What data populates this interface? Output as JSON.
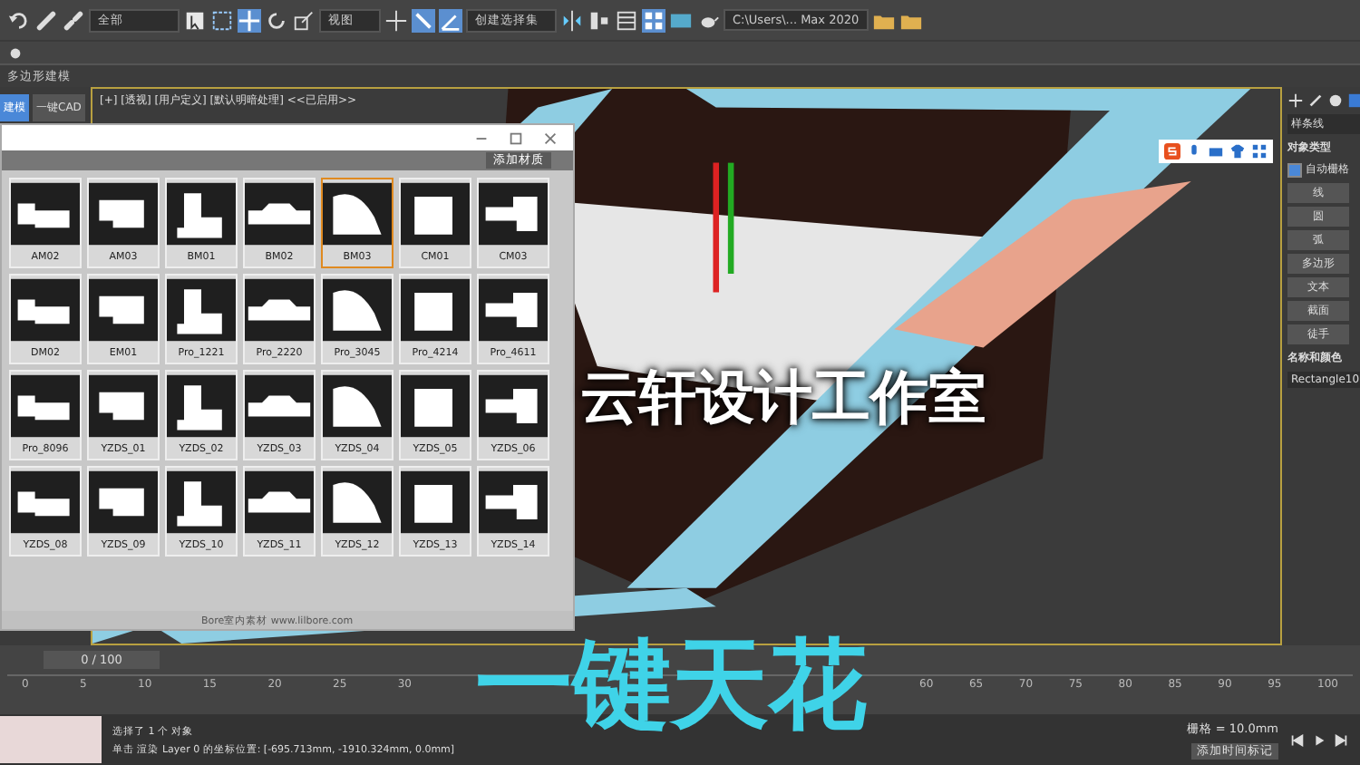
{
  "toolbar": {
    "selection_filter": "全部",
    "view_dropdown": "视图",
    "named_selection": "创建选择集",
    "path_field": "C:\\Users\\... Max 2020"
  },
  "ribbon_label": "多边形建模",
  "side_tabs": [
    {
      "label": "建模",
      "selected": true
    },
    {
      "label": "一键CAD",
      "selected": false
    }
  ],
  "viewport": {
    "label": "[+] [透视] [用户定义] [默认明暗处理] <<已启用>>"
  },
  "library_window": {
    "add_button": "添加材质",
    "footer": "Bore室内素材 www.lilbore.com",
    "items": [
      {
        "label": "AM02",
        "selected": false
      },
      {
        "label": "AM03",
        "selected": false
      },
      {
        "label": "BM01",
        "selected": false
      },
      {
        "label": "BM02",
        "selected": false
      },
      {
        "label": "BM03",
        "selected": true
      },
      {
        "label": "CM01",
        "selected": false
      },
      {
        "label": "CM03",
        "selected": false
      },
      {
        "label": "DM02",
        "selected": false
      },
      {
        "label": "EM01",
        "selected": false
      },
      {
        "label": "Pro_1221",
        "selected": false
      },
      {
        "label": "Pro_2220",
        "selected": false
      },
      {
        "label": "Pro_3045",
        "selected": false
      },
      {
        "label": "Pro_4214",
        "selected": false
      },
      {
        "label": "Pro_4611",
        "selected": false
      },
      {
        "label": "Pro_8096",
        "selected": false
      },
      {
        "label": "YZDS_01",
        "selected": false
      },
      {
        "label": "YZDS_02",
        "selected": false
      },
      {
        "label": "YZDS_03",
        "selected": false
      },
      {
        "label": "YZDS_04",
        "selected": false
      },
      {
        "label": "YZDS_05",
        "selected": false
      },
      {
        "label": "YZDS_06",
        "selected": false
      },
      {
        "label": "YZDS_08",
        "selected": false
      },
      {
        "label": "YZDS_09",
        "selected": false
      },
      {
        "label": "YZDS_10",
        "selected": false
      },
      {
        "label": "YZDS_11",
        "selected": false
      },
      {
        "label": "YZDS_12",
        "selected": false
      },
      {
        "label": "YZDS_13",
        "selected": false
      },
      {
        "label": "YZDS_14",
        "selected": false
      }
    ]
  },
  "command_panel": {
    "dropdown": "样条线",
    "object_type": {
      "title": "对象类型",
      "autogrid": "自动栅格",
      "autogrid_checked": true,
      "buttons": [
        "线",
        "圆",
        "弧",
        "多边形",
        "文本",
        "截面",
        "徒手"
      ]
    },
    "name_color": {
      "title": "名称和颜色",
      "name": "Rectangle10"
    }
  },
  "timeline": {
    "frame": "0 / 100",
    "level": 0,
    "ticks_before_caption": [
      "0",
      "5",
      "10",
      "15",
      "20",
      "25",
      "30"
    ],
    "ticks_after_caption": [
      "60",
      "65",
      "70",
      "75",
      "80",
      "85",
      "90",
      "95",
      "100"
    ]
  },
  "status": {
    "selection": "选择了 1 个 对象",
    "prompt": "单击 渲染 Layer 0 的坐标位置: [-695.713mm, -1910.324mm, 0.0mm]",
    "grid": "栅格 = 10.0mm",
    "time_tag": "添加时间标记"
  },
  "captions": [
    {
      "kind": "studio",
      "text": "云轩设计工作室"
    },
    {
      "kind": "title",
      "text": "一键天花"
    }
  ]
}
